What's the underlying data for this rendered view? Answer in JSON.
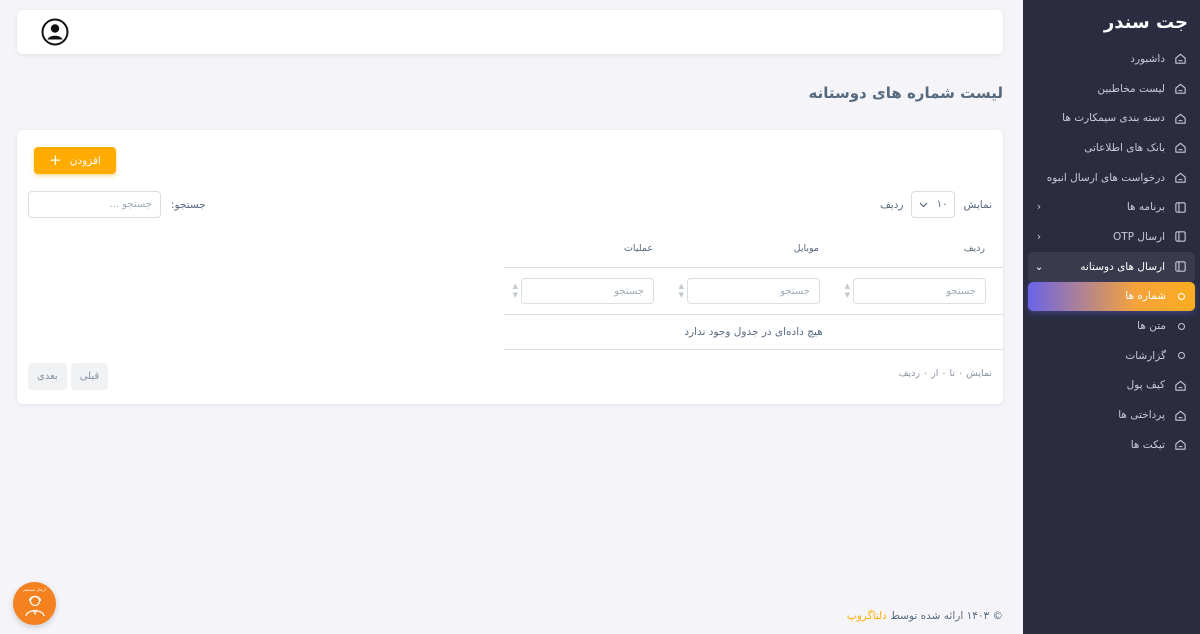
{
  "app": {
    "brand": "جت سندر"
  },
  "sidebar": {
    "items": [
      {
        "label": "داشبورد",
        "icon": "home-icon"
      },
      {
        "label": "لیست مخاطبین",
        "icon": "home-icon"
      },
      {
        "label": "دسته بندی سیمکارت ها",
        "icon": "home-icon"
      },
      {
        "label": "بانک های اطلاعاتی",
        "icon": "home-icon"
      },
      {
        "label": "درخواست های ارسال انبوه",
        "icon": "home-icon"
      },
      {
        "label": "برنامه ها",
        "icon": "layout-icon",
        "arrow": "‹"
      },
      {
        "label": "ارسال OTP",
        "icon": "layout-icon",
        "arrow": "‹"
      },
      {
        "label": "ارسال های دوستانه",
        "icon": "layout-icon",
        "arrow": "⌄",
        "open": true
      },
      {
        "label": "شماره ها",
        "sub": true,
        "active": true
      },
      {
        "label": "متن ها",
        "sub": true
      },
      {
        "label": "گزارشات",
        "sub": true
      },
      {
        "label": "کیف پول",
        "icon": "home-icon"
      },
      {
        "label": "پرداختی ها",
        "icon": "home-icon"
      },
      {
        "label": "تیکت ها",
        "icon": "home-icon"
      }
    ]
  },
  "page": {
    "title": "لیست شماره های دوستانه"
  },
  "toolbar": {
    "add_label": "افزودن"
  },
  "table_controls": {
    "show_label": "نمایش",
    "rows_label": "ردیف",
    "page_length": "۱۰",
    "search_label": "جستجو:",
    "search_placeholder": "جستجو ..."
  },
  "table": {
    "columns": [
      "ردیف",
      "موبایل",
      "عملیات"
    ],
    "filter_placeholder": "جستجو",
    "empty_message": "هیچ داده‌ای در جدول وجود ندارد",
    "info": "نمایش ۰ تا ۰ از ۰ ردیف"
  },
  "pagination": {
    "prev_label": "قبلی",
    "next_label": "بعدی"
  },
  "footer": {
    "prefix": "© ۱۴۰۳ ارائه شده توسط",
    "link": "دلتاگروپ"
  },
  "support": {
    "label": "آرمان سیستم"
  },
  "colors": {
    "sidebar_bg": "#2b2c40",
    "accent": "#ffab00",
    "active_gradient_end": "#6a63e8",
    "page_bg": "#f5f5f9"
  }
}
